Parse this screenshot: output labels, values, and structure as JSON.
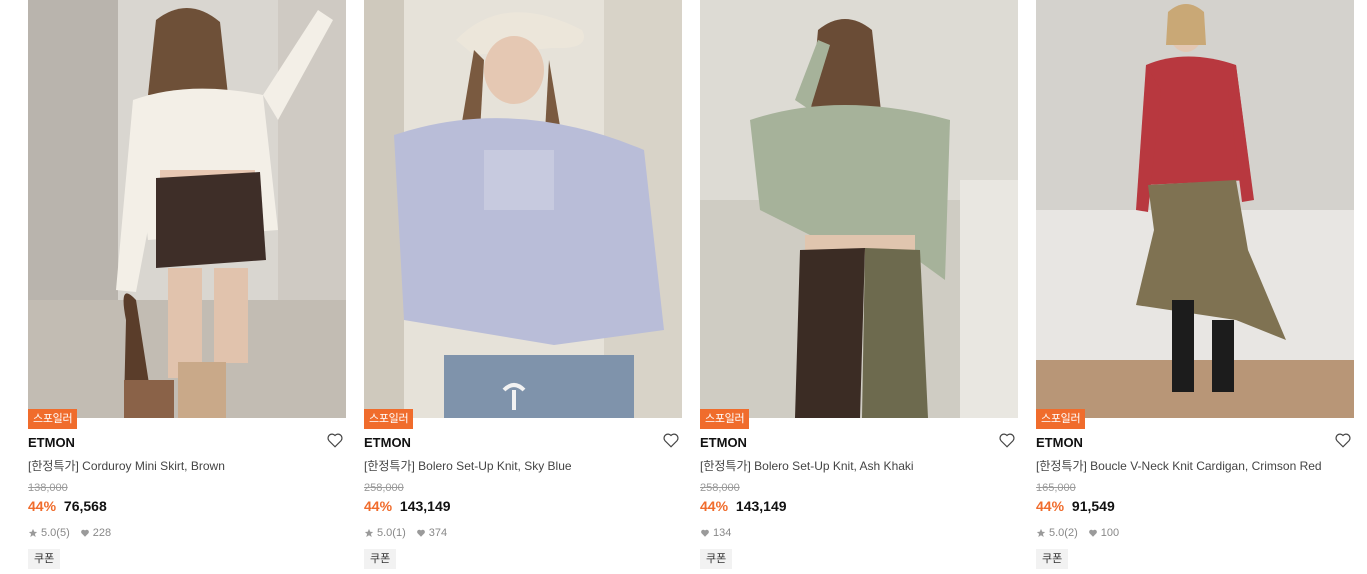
{
  "products": [
    {
      "badge": "스포일러",
      "brand": "ETMON",
      "name": "[한정특가] Corduroy Mini Skirt, Brown",
      "original_price": "138,000",
      "discount": "44%",
      "price": "76,568",
      "rating": "5.0",
      "reviews": "(5)",
      "likes": "228",
      "coupon": "쿠폰"
    },
    {
      "badge": "스포일러",
      "brand": "ETMON",
      "name": "[한정특가] Bolero Set-Up Knit, Sky Blue",
      "original_price": "258,000",
      "discount": "44%",
      "price": "143,149",
      "rating": "5.0",
      "reviews": "(1)",
      "likes": "374",
      "coupon": "쿠폰"
    },
    {
      "badge": "스포일러",
      "brand": "ETMON",
      "name": "[한정특가] Bolero Set-Up Knit, Ash Khaki",
      "original_price": "258,000",
      "discount": "44%",
      "price": "143,149",
      "likes": "134",
      "coupon": "쿠폰"
    },
    {
      "badge": "스포일러",
      "brand": "ETMON",
      "name": "[한정특가] Boucle V-Neck Knit Cardigan, Crimson Red",
      "original_price": "165,000",
      "discount": "44%",
      "price": "91,549",
      "rating": "5.0",
      "reviews": "(2)",
      "likes": "100",
      "coupon": "쿠폰"
    }
  ],
  "colors": {
    "accent": "#f06c2c",
    "star": "#9a9a9a",
    "heart": "#9a9a9a"
  },
  "icons": {
    "like": "heart-outline-icon",
    "star": "star-icon",
    "likes": "heart-filled-icon"
  }
}
